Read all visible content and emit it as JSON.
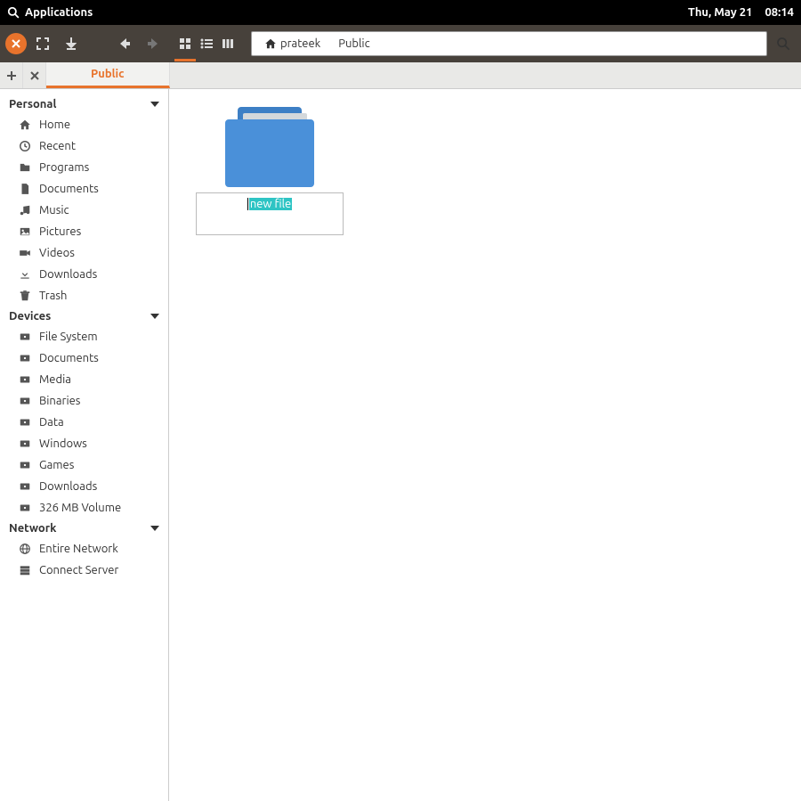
{
  "topbar": {
    "applications_label": "Applications",
    "date": "Thu, May 21",
    "time": "08:14"
  },
  "pathbar": {
    "home_user": "prateek",
    "segment2": "Public"
  },
  "tabs": {
    "active": "Public"
  },
  "sidebar": {
    "sections": {
      "personal": {
        "title": "Personal",
        "items": [
          "Home",
          "Recent",
          "Programs",
          "Documents",
          "Music",
          "Pictures",
          "Videos",
          "Downloads",
          "Trash"
        ]
      },
      "devices": {
        "title": "Devices",
        "items": [
          "File System",
          "Documents",
          "Media",
          "Binaries",
          "Data",
          "Windows",
          "Games",
          "Downloads",
          "326 MB Volume"
        ]
      },
      "network": {
        "title": "Network",
        "items": [
          "Entire Network",
          "Connect Server"
        ]
      }
    }
  },
  "content": {
    "rename_value": "new file"
  }
}
